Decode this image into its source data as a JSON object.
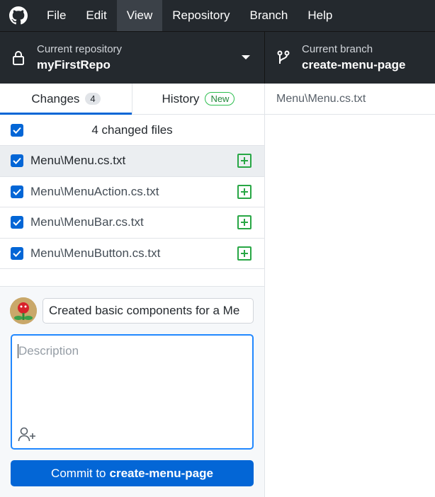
{
  "menu": [
    "File",
    "Edit",
    "View",
    "Repository",
    "Branch",
    "Help"
  ],
  "toolbar": {
    "repo_caption": "Current repository",
    "repo_name": "myFirstRepo",
    "branch_caption": "Current branch",
    "branch_name": "create-menu-page"
  },
  "tabs": {
    "changes_label": "Changes",
    "changes_count": "4",
    "history_label": "History",
    "history_badge": "New"
  },
  "diff_header": "Menu\\Menu.cs.txt",
  "file_list": {
    "header": "4 changed files",
    "files": [
      "Menu\\Menu.cs.txt",
      "Menu\\MenuAction.cs.txt",
      "Menu\\MenuBar.cs.txt",
      "Menu\\MenuButton.cs.txt"
    ]
  },
  "commit": {
    "summary_value": "Created basic components for a Me",
    "description_placeholder": "Description",
    "button_prefix": "Commit to",
    "button_branch": "create-menu-page"
  },
  "colors": {
    "accent": "#0366d6",
    "added": "#28a745",
    "titlebar": "#24292e"
  }
}
